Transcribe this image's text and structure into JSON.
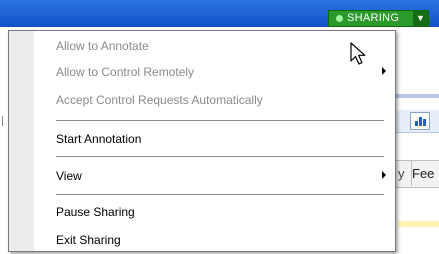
{
  "sharing_badge": {
    "label": "SHARING"
  },
  "background_app": {
    "column_header_fragment_1": "y",
    "column_header_fragment_2": "Fee"
  },
  "menu": {
    "items": [
      {
        "label": "Allow to Annotate",
        "enabled": false,
        "submenu": false
      },
      {
        "label": "Allow to Control Remotely",
        "enabled": false,
        "submenu": true
      },
      {
        "label": "Accept Control Requests Automatically",
        "enabled": false,
        "submenu": false
      },
      {
        "label": "Start Annotation",
        "enabled": true,
        "submenu": false
      },
      {
        "label": "View",
        "enabled": true,
        "submenu": true
      },
      {
        "label": "Pause Sharing",
        "enabled": true,
        "submenu": false
      },
      {
        "label": "Exit Sharing",
        "enabled": true,
        "submenu": false
      }
    ]
  },
  "colors": {
    "titlebar": "#1f5fd6",
    "sharing": "#2a9b2a",
    "disabled_text": "#8a8a8a"
  }
}
